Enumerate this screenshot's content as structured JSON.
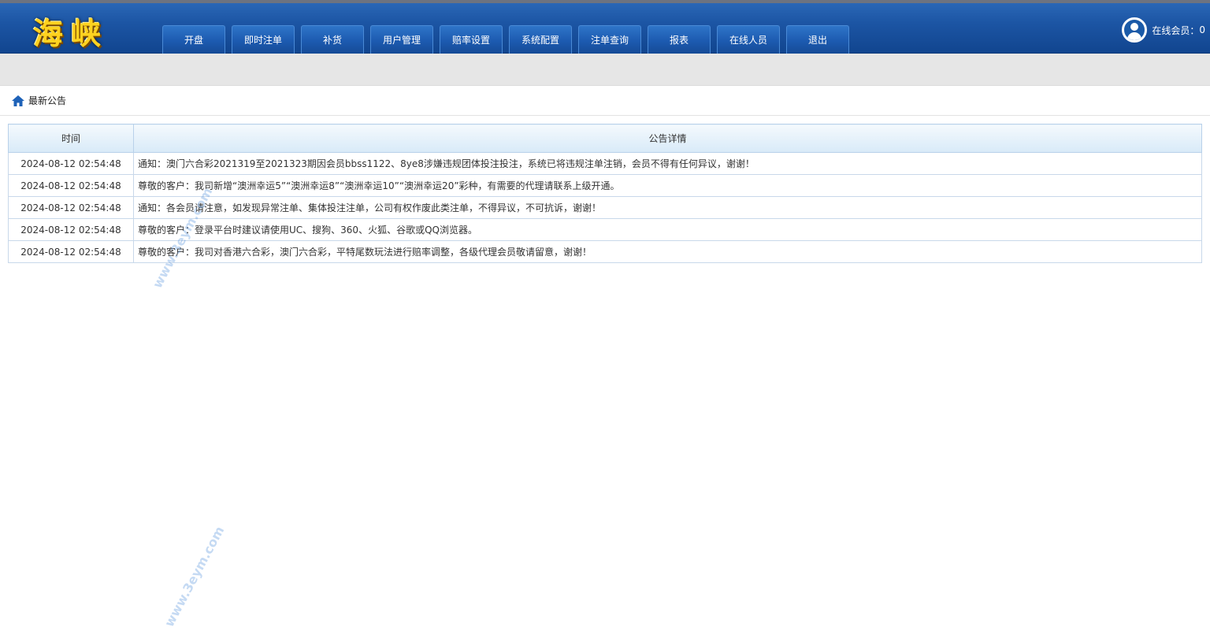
{
  "header": {
    "logo_text": "海峡",
    "nav": [
      "开盘",
      "即时注单",
      "补货",
      "用户管理",
      "赔率设置",
      "系统配置",
      "注单查询",
      "报表",
      "在线人员",
      "退出"
    ],
    "online_label": "在线会员：",
    "online_count": "0"
  },
  "section": {
    "title": "最新公告"
  },
  "table": {
    "headers": [
      "时间",
      "公告详情"
    ],
    "rows": [
      {
        "time": "2024-08-12 02:54:48",
        "detail": "通知：澳门六合彩2021319至2021323期因会员bbss1122、8ye8涉嫌违规团体投注投注，系统已将违规注单注销，会员不得有任何异议，谢谢！"
      },
      {
        "time": "2024-08-12 02:54:48",
        "detail": "尊敬的客户：我司新增“澳洲幸运5”“澳洲幸运8”“澳洲幸运10”“澳洲幸运20”彩种，有需要的代理请联系上级开通。"
      },
      {
        "time": "2024-08-12 02:54:48",
        "detail": "通知：各会员请注意，如发现异常注单、集体投注注单，公司有权作废此类注单，不得异议，不可抗诉，谢谢！"
      },
      {
        "time": "2024-08-12 02:54:48",
        "detail": "尊敬的客户：登录平台时建议请使用UC、搜狗、360、火狐、谷歌或QQ浏览器。"
      },
      {
        "time": "2024-08-12 02:54:48",
        "detail": "尊敬的客户：我司对香港六合彩，澳门六合彩，平特尾数玩法进行赔率调整，各级代理会员敬请留意，谢谢！"
      }
    ]
  },
  "watermark": {
    "text": "www.3eym.com"
  },
  "colors": {
    "header_blue": "#1c55a4",
    "logo_yellow": "#ffd21f",
    "table_head": "#d8eaf8"
  }
}
